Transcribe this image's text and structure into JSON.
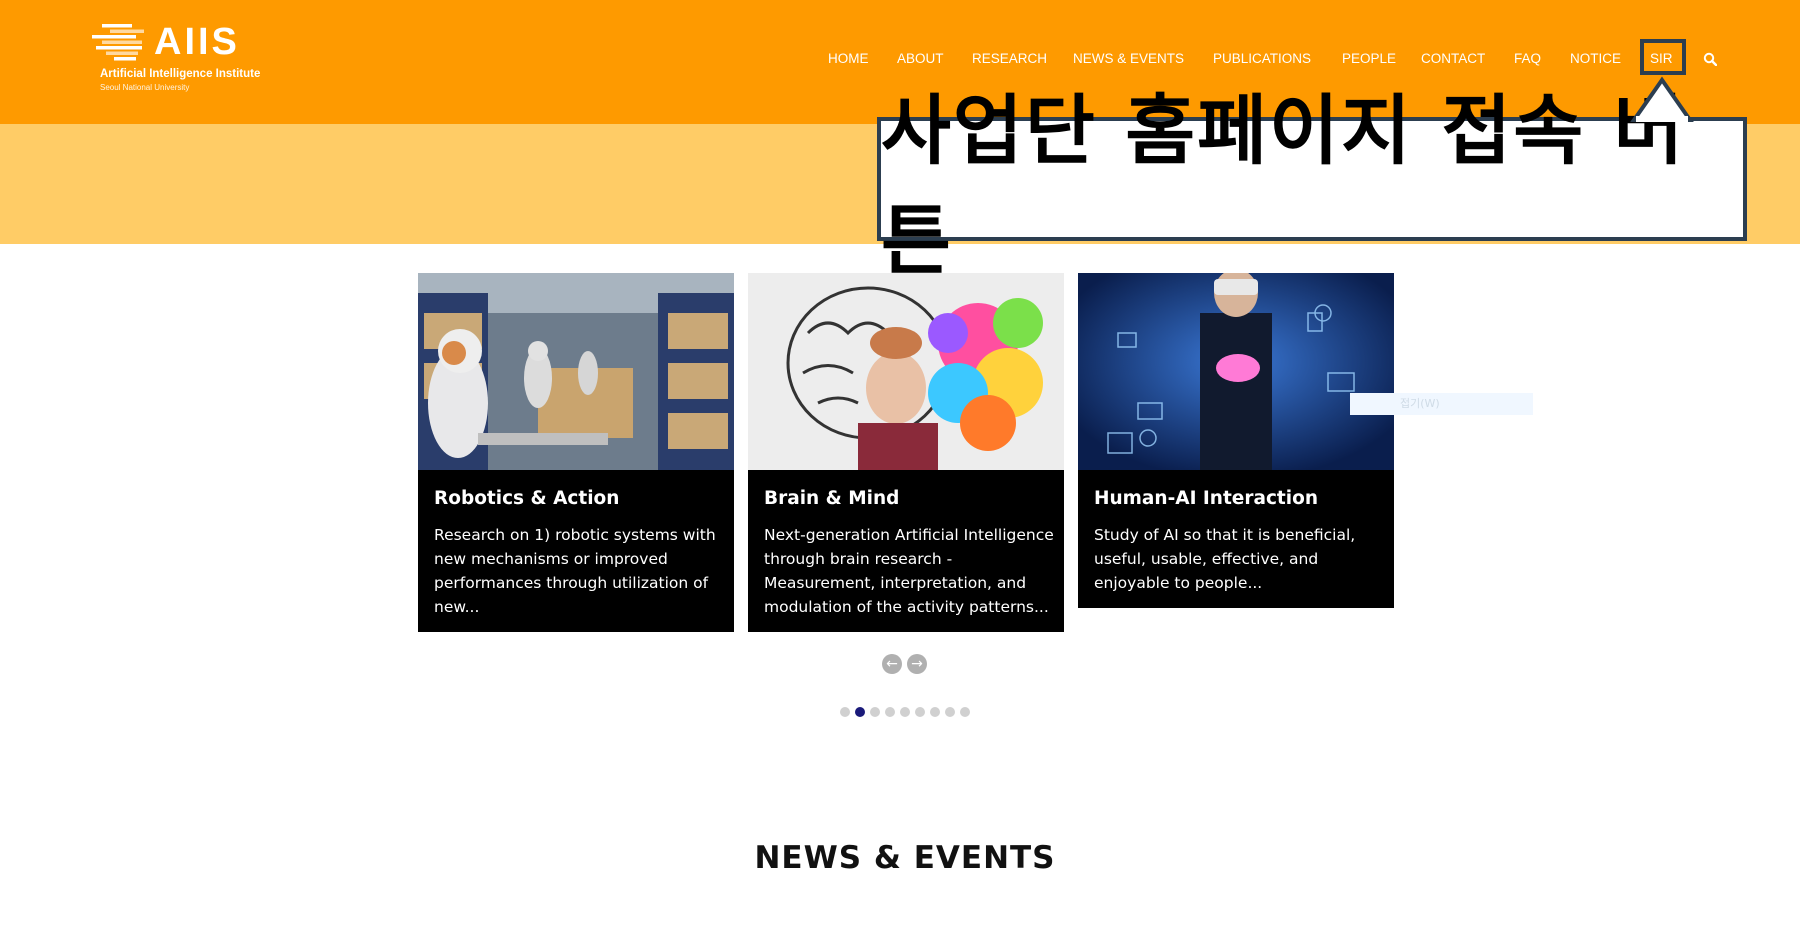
{
  "header": {
    "logo_text": "AIIS",
    "logo_sub": "Artificial Intelligence Institute",
    "logo_sub2": "Seoul National University",
    "nav": [
      {
        "label": "HOME"
      },
      {
        "label": "ABOUT"
      },
      {
        "label": "RESEARCH"
      },
      {
        "label": "NEWS & EVENTS"
      },
      {
        "label": "PUBLICATIONS"
      },
      {
        "label": "PEOPLE"
      },
      {
        "label": "CONTACT"
      },
      {
        "label": "FAQ"
      },
      {
        "label": "NOTICE"
      },
      {
        "label": "SIR"
      }
    ],
    "search_icon": "search-icon"
  },
  "callout": {
    "text": "사업단 홈페이지 접속 버튼"
  },
  "cards": [
    {
      "title": "Robotics & Action",
      "desc": "Research on 1) robotic systems with new mechanisms or improved performances through utilization of new..."
    },
    {
      "title": "Brain & Mind",
      "desc": "Next-generation Artificial Intelligence through brain research - Measurement, interpretation, and modulation of the activity patterns..."
    },
    {
      "title": "Human-AI Interaction",
      "desc": "Study of AI so that it is beneficial, useful, usable, effective, and enjoyable to people..."
    }
  ],
  "carousel": {
    "prev_icon": "arrow-left-icon",
    "next_icon": "arrow-right-icon",
    "dot_count": 9,
    "active_dot": 2
  },
  "ghost_label": "접기(W)",
  "section": {
    "title": "NEWS & EVENTS"
  },
  "colors": {
    "header": "#fe9a00",
    "band": "#ffcc66",
    "callout_border": "#2c3e50",
    "card_bg": "#000000",
    "active_dot": "#1a1a7a"
  }
}
